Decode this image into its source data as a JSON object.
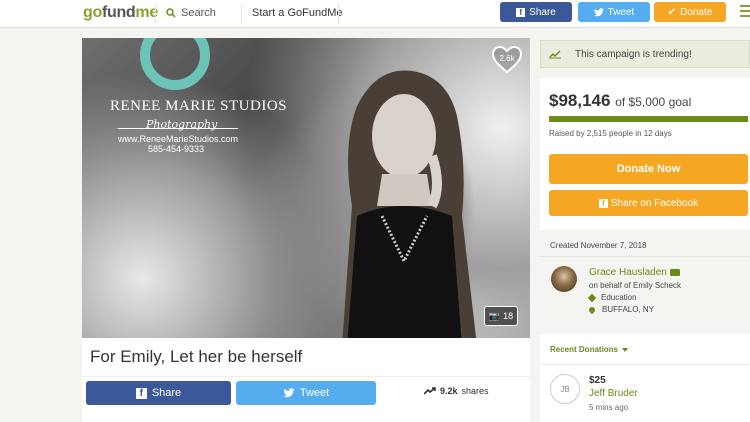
{
  "header": {
    "logo": {
      "part1": "go",
      "part2": "fund",
      "part3": "me"
    },
    "search_label": "Search",
    "start_label": "Start a GoFundMe",
    "share_label": "Share",
    "tweet_label": "Tweet",
    "donate_label": "Donate"
  },
  "photo": {
    "studio_title": "RENEE MARIE STUDIOS",
    "studio_subtitle": "Photography",
    "studio_url": "www.ReneeMarieStudios.com",
    "studio_phone": "585-454-9333",
    "heart_count": "2.6k",
    "photo_count": "18"
  },
  "campaign": {
    "title": "For Emily, Let her be herself",
    "share_label": "Share",
    "tweet_label": "Tweet",
    "shares_count": "9.2k",
    "shares_suffix": "shares"
  },
  "sidebar": {
    "trending_text": "This campaign is trending!",
    "raised_amount": "$98,146",
    "goal_text": "of $5,000 goal",
    "progress_fraction": 1.0,
    "raised_by": "Raised by 2,515 people in 12 days",
    "donate_now": "Donate Now",
    "share_facebook": "Share on Facebook"
  },
  "organizer": {
    "created": "Created November 7, 2018",
    "name": "Grace Hausladen",
    "behalf": "on behalf of Emily Scheck",
    "category": "Education",
    "location": "BUFFALO, NY"
  },
  "recent": {
    "title": "Recent Donations",
    "donations": [
      {
        "initials": "JB",
        "amount": "$25",
        "name": "Jeff Bruder",
        "time": "5 mins ago"
      }
    ]
  },
  "colors": {
    "brand_green": "#6a8a1c",
    "facebook": "#3b5998",
    "twitter": "#55acee",
    "donate_orange": "#f5a623"
  }
}
